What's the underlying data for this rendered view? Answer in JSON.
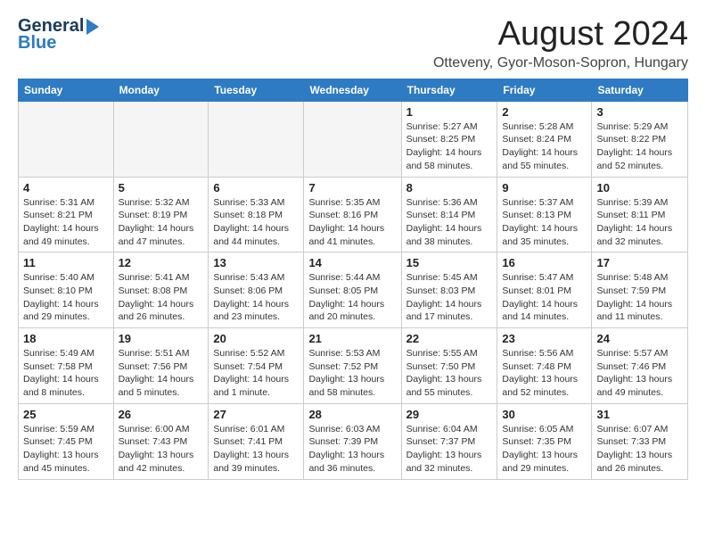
{
  "logo": {
    "line1": "General",
    "line2": "Blue"
  },
  "title": "August 2024",
  "subtitle": "Otteveny, Gyor-Moson-Sopron, Hungary",
  "weekdays": [
    "Sunday",
    "Monday",
    "Tuesday",
    "Wednesday",
    "Thursday",
    "Friday",
    "Saturday"
  ],
  "weeks": [
    [
      {
        "day": "",
        "info": ""
      },
      {
        "day": "",
        "info": ""
      },
      {
        "day": "",
        "info": ""
      },
      {
        "day": "",
        "info": ""
      },
      {
        "day": "1",
        "info": "Sunrise: 5:27 AM\nSunset: 8:25 PM\nDaylight: 14 hours\nand 58 minutes."
      },
      {
        "day": "2",
        "info": "Sunrise: 5:28 AM\nSunset: 8:24 PM\nDaylight: 14 hours\nand 55 minutes."
      },
      {
        "day": "3",
        "info": "Sunrise: 5:29 AM\nSunset: 8:22 PM\nDaylight: 14 hours\nand 52 minutes."
      }
    ],
    [
      {
        "day": "4",
        "info": "Sunrise: 5:31 AM\nSunset: 8:21 PM\nDaylight: 14 hours\nand 49 minutes."
      },
      {
        "day": "5",
        "info": "Sunrise: 5:32 AM\nSunset: 8:19 PM\nDaylight: 14 hours\nand 47 minutes."
      },
      {
        "day": "6",
        "info": "Sunrise: 5:33 AM\nSunset: 8:18 PM\nDaylight: 14 hours\nand 44 minutes."
      },
      {
        "day": "7",
        "info": "Sunrise: 5:35 AM\nSunset: 8:16 PM\nDaylight: 14 hours\nand 41 minutes."
      },
      {
        "day": "8",
        "info": "Sunrise: 5:36 AM\nSunset: 8:14 PM\nDaylight: 14 hours\nand 38 minutes."
      },
      {
        "day": "9",
        "info": "Sunrise: 5:37 AM\nSunset: 8:13 PM\nDaylight: 14 hours\nand 35 minutes."
      },
      {
        "day": "10",
        "info": "Sunrise: 5:39 AM\nSunset: 8:11 PM\nDaylight: 14 hours\nand 32 minutes."
      }
    ],
    [
      {
        "day": "11",
        "info": "Sunrise: 5:40 AM\nSunset: 8:10 PM\nDaylight: 14 hours\nand 29 minutes."
      },
      {
        "day": "12",
        "info": "Sunrise: 5:41 AM\nSunset: 8:08 PM\nDaylight: 14 hours\nand 26 minutes."
      },
      {
        "day": "13",
        "info": "Sunrise: 5:43 AM\nSunset: 8:06 PM\nDaylight: 14 hours\nand 23 minutes."
      },
      {
        "day": "14",
        "info": "Sunrise: 5:44 AM\nSunset: 8:05 PM\nDaylight: 14 hours\nand 20 minutes."
      },
      {
        "day": "15",
        "info": "Sunrise: 5:45 AM\nSunset: 8:03 PM\nDaylight: 14 hours\nand 17 minutes."
      },
      {
        "day": "16",
        "info": "Sunrise: 5:47 AM\nSunset: 8:01 PM\nDaylight: 14 hours\nand 14 minutes."
      },
      {
        "day": "17",
        "info": "Sunrise: 5:48 AM\nSunset: 7:59 PM\nDaylight: 14 hours\nand 11 minutes."
      }
    ],
    [
      {
        "day": "18",
        "info": "Sunrise: 5:49 AM\nSunset: 7:58 PM\nDaylight: 14 hours\nand 8 minutes."
      },
      {
        "day": "19",
        "info": "Sunrise: 5:51 AM\nSunset: 7:56 PM\nDaylight: 14 hours\nand 5 minutes."
      },
      {
        "day": "20",
        "info": "Sunrise: 5:52 AM\nSunset: 7:54 PM\nDaylight: 14 hours\nand 1 minute."
      },
      {
        "day": "21",
        "info": "Sunrise: 5:53 AM\nSunset: 7:52 PM\nDaylight: 13 hours\nand 58 minutes."
      },
      {
        "day": "22",
        "info": "Sunrise: 5:55 AM\nSunset: 7:50 PM\nDaylight: 13 hours\nand 55 minutes."
      },
      {
        "day": "23",
        "info": "Sunrise: 5:56 AM\nSunset: 7:48 PM\nDaylight: 13 hours\nand 52 minutes."
      },
      {
        "day": "24",
        "info": "Sunrise: 5:57 AM\nSunset: 7:46 PM\nDaylight: 13 hours\nand 49 minutes."
      }
    ],
    [
      {
        "day": "25",
        "info": "Sunrise: 5:59 AM\nSunset: 7:45 PM\nDaylight: 13 hours\nand 45 minutes."
      },
      {
        "day": "26",
        "info": "Sunrise: 6:00 AM\nSunset: 7:43 PM\nDaylight: 13 hours\nand 42 minutes."
      },
      {
        "day": "27",
        "info": "Sunrise: 6:01 AM\nSunset: 7:41 PM\nDaylight: 13 hours\nand 39 minutes."
      },
      {
        "day": "28",
        "info": "Sunrise: 6:03 AM\nSunset: 7:39 PM\nDaylight: 13 hours\nand 36 minutes."
      },
      {
        "day": "29",
        "info": "Sunrise: 6:04 AM\nSunset: 7:37 PM\nDaylight: 13 hours\nand 32 minutes."
      },
      {
        "day": "30",
        "info": "Sunrise: 6:05 AM\nSunset: 7:35 PM\nDaylight: 13 hours\nand 29 minutes."
      },
      {
        "day": "31",
        "info": "Sunrise: 6:07 AM\nSunset: 7:33 PM\nDaylight: 13 hours\nand 26 minutes."
      }
    ]
  ]
}
